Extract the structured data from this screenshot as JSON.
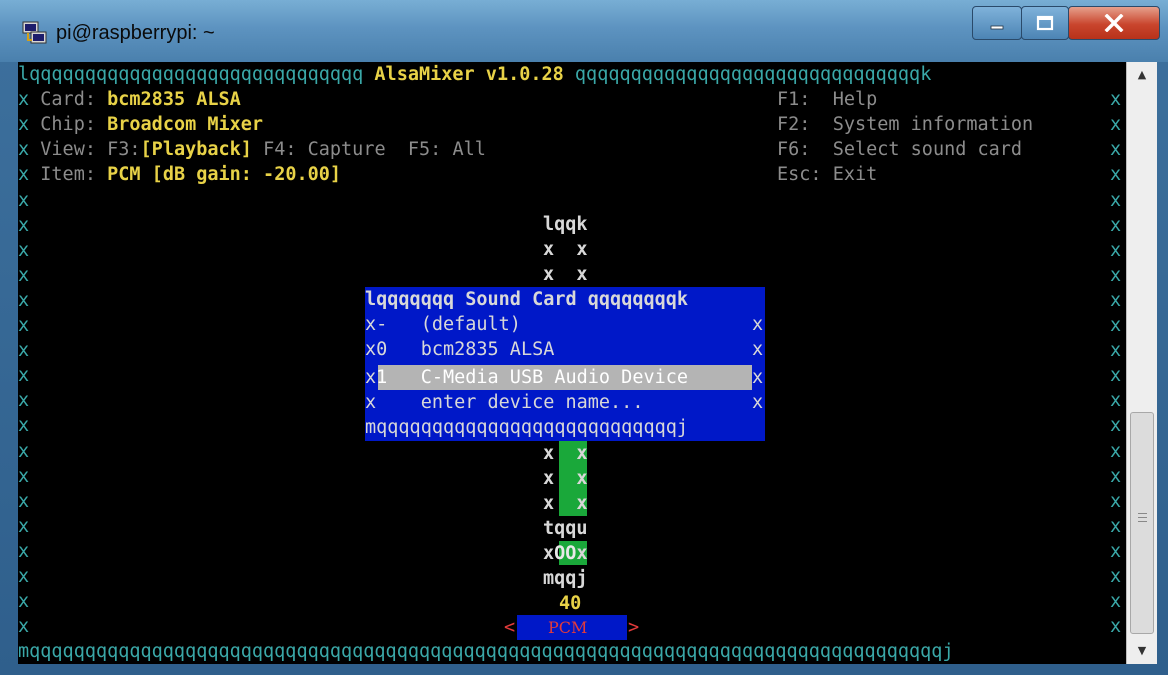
{
  "window": {
    "title": "pi@raspberrypi: ~",
    "icons": {
      "app": "putty-icon",
      "minimize": "minimize-icon",
      "maximize": "maximize-icon",
      "close": "close-icon"
    }
  },
  "mixer": {
    "top_border_left": "lqqqqqqqqqqqqqqqqqqqqqqqqqqqqqq",
    "app_name": "AlsaMixer v1.0.28",
    "top_border_right": "qqqqqqqqqqqqqqqqqqqqqqqqqqqqqqqk",
    "card_label": "Card:",
    "card_value": "bcm2835 ALSA",
    "chip_label": "Chip:",
    "chip_value": "Broadcom Mixer",
    "view_label": "View:",
    "view_f3_key": "F3:",
    "view_f3_value": "[Playback]",
    "view_f4": "F4: Capture",
    "view_f5": "F5: All",
    "item_label": "Item:",
    "item_value": "PCM [dB gain: -20.00]",
    "help": [
      {
        "key": "F1:",
        "label": "Help"
      },
      {
        "key": "F2:",
        "label": "System information"
      },
      {
        "key": "F6:",
        "label": "Select sound card"
      },
      {
        "key": "Esc:",
        "label": "Exit"
      }
    ],
    "side_char": "x",
    "bottom_border": "mqqqqqqqqqqqqqqqqqqqqqqqqqqqqqqqqqqqqqqqqqqqqqqqqqqqqqqqqqqqqqqqqqqqqqqqqqqqqqqqqqqj"
  },
  "control": {
    "top": "lqqk",
    "side": "x  x",
    "tee": "tqqu",
    "oo_left": "x",
    "oo": "OO",
    "oo_right": "x",
    "bottom": "mqqj",
    "volume": "40",
    "name": "PCM",
    "arrow_left": "<",
    "arrow_right": ">",
    "level_fraction": 0.4
  },
  "sound_card_dialog": {
    "title_left": "lqqqqqqq",
    "title": "Sound Card",
    "title_right": "qqqqqqqqk",
    "items": [
      {
        "index": "-",
        "name": "(default)",
        "selected": false
      },
      {
        "index": "0",
        "name": "bcm2835 ALSA",
        "selected": false
      },
      {
        "index": "1",
        "name": "C-Media USB Audio Device",
        "selected": true
      },
      {
        "index": "",
        "name": "enter device name...",
        "selected": false
      }
    ],
    "bottom": "mqqqqqqqqqqqqqqqqqqqqqqqqqqqj"
  },
  "scrollbar": {
    "up": "▲",
    "down": "▼"
  }
}
